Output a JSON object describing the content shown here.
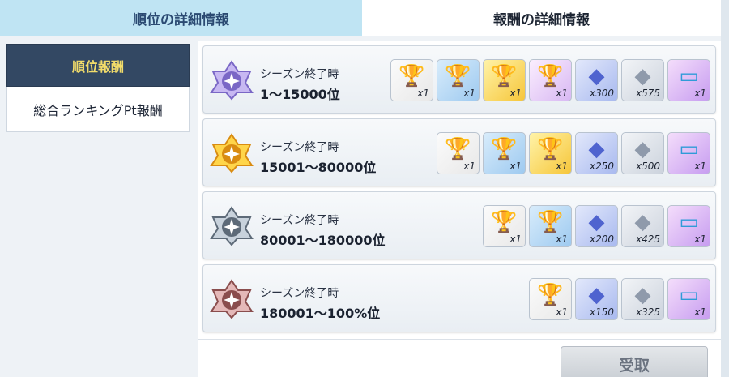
{
  "tabs": {
    "ranking_details": "順位の詳細情報",
    "reward_details": "報酬の詳細情報"
  },
  "sidebar": {
    "header": "順位報酬",
    "item": "総合ランキングPt報酬"
  },
  "colors": {
    "tab_inactive_bg": "#bfe4f3",
    "sidebar_header_bg": "#334863",
    "sidebar_header_text": "#f2dc6a"
  },
  "rows": [
    {
      "title": "シーズン終了時",
      "range": "1～15000位",
      "emblem": "purple-rank-emblem",
      "items": [
        {
          "icon": "bronze-trophy-icon",
          "qty": "x1"
        },
        {
          "icon": "silver-trophy-icon",
          "qty": "x1"
        },
        {
          "icon": "gold-trophy-icon",
          "qty": "x1"
        },
        {
          "icon": "rainbow-trophy-icon",
          "qty": "x1"
        },
        {
          "icon": "blue-gem-icon",
          "qty": "x300"
        },
        {
          "icon": "silver-gem-icon",
          "qty": "x575"
        },
        {
          "icon": "ticket-icon",
          "qty": "x1"
        }
      ]
    },
    {
      "title": "シーズン終了時",
      "range": "15001～80000位",
      "emblem": "gold-rank-emblem",
      "items": [
        {
          "icon": "bronze-trophy-icon",
          "qty": "x1"
        },
        {
          "icon": "silver-trophy-icon",
          "qty": "x1"
        },
        {
          "icon": "gold-trophy-icon",
          "qty": "x1"
        },
        {
          "icon": "blue-gem-icon",
          "qty": "x250"
        },
        {
          "icon": "silver-gem-icon",
          "qty": "x500"
        },
        {
          "icon": "ticket-icon",
          "qty": "x1"
        }
      ]
    },
    {
      "title": "シーズン終了時",
      "range": "80001～180000位",
      "emblem": "silver-rank-emblem",
      "items": [
        {
          "icon": "bronze-trophy-icon",
          "qty": "x1"
        },
        {
          "icon": "silver-trophy-icon",
          "qty": "x1"
        },
        {
          "icon": "blue-gem-icon",
          "qty": "x200"
        },
        {
          "icon": "silver-gem-icon",
          "qty": "x425"
        },
        {
          "icon": "ticket-icon",
          "qty": "x1"
        }
      ]
    },
    {
      "title": "シーズン終了時",
      "range": "180001～100%位",
      "emblem": "bronze-rank-emblem",
      "items": [
        {
          "icon": "bronze-trophy-icon",
          "qty": "x1"
        },
        {
          "icon": "blue-gem-icon",
          "qty": "x150"
        },
        {
          "icon": "silver-gem-icon",
          "qty": "x325"
        },
        {
          "icon": "ticket-icon",
          "qty": "x1"
        }
      ]
    }
  ],
  "claim_button": "受取"
}
